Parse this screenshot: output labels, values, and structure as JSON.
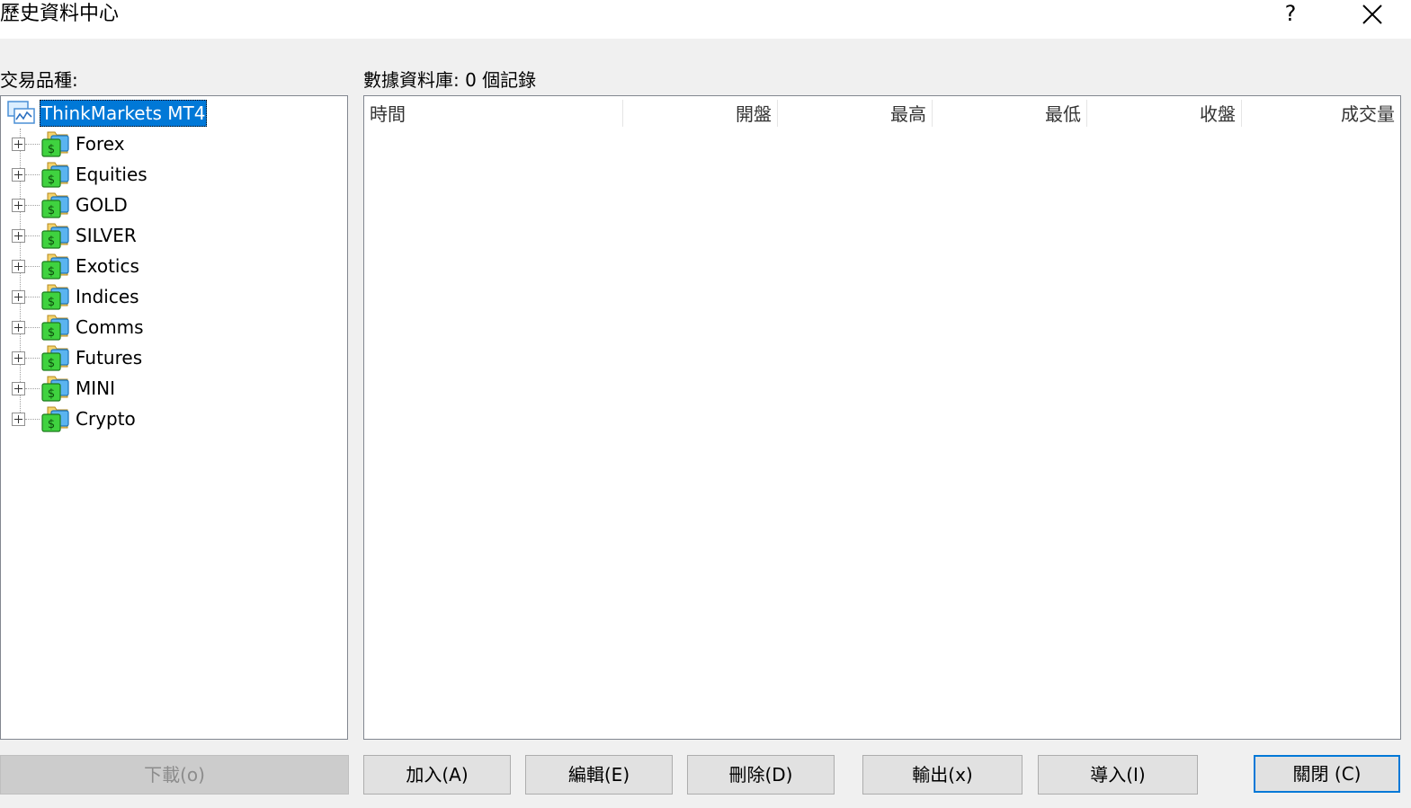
{
  "window": {
    "title": "歷史資料中心",
    "help_label": "?"
  },
  "symbols_label": "交易品種:",
  "database_label": "數據資料庫: 0 個記錄",
  "tree": {
    "root": "ThinkMarkets MT4",
    "groups": [
      "Forex",
      "Equities",
      "GOLD",
      "SILVER",
      "Exotics",
      "Indices",
      "Comms",
      "Futures",
      "MINI",
      "Crypto"
    ]
  },
  "grid": {
    "columns": [
      "時間",
      "開盤",
      "最高",
      "最低",
      "收盤",
      "成交量"
    ]
  },
  "buttons": {
    "download": "下載(o)",
    "add": "加入(A)",
    "edit": "編輯(E)",
    "delete": "刪除(D)",
    "export": "輸出(x)",
    "import": "導入(I)",
    "close": "關閉 (C)"
  },
  "icons": {
    "root": "server-chart-icon",
    "group": "money-folder-icon"
  }
}
